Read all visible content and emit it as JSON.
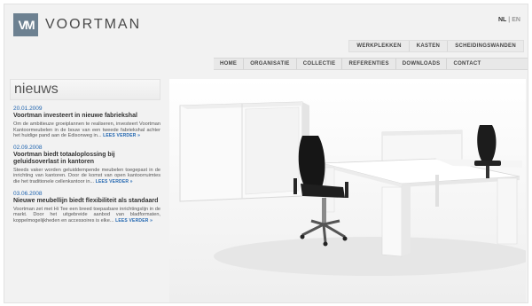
{
  "brand": {
    "mark": "VM",
    "name": "VOORTMAN"
  },
  "language": {
    "nl": "NL",
    "separator": "|",
    "en": "EN"
  },
  "top_nav": [
    "WERKPLEKKEN",
    "KASTEN",
    "SCHEIDINGSWANDEN"
  ],
  "main_nav": [
    "HOME",
    "ORGANISATIE",
    "COLLECTIE",
    "REFERENTIES",
    "DOWNLOADS",
    "CONTACT"
  ],
  "news": {
    "heading": "nieuws",
    "items": [
      {
        "date": "20.01.2009",
        "title": "Voortman investeert in nieuwe fabriekshal",
        "body": "Om de ambitieuze groeiplannen te realiseren, investeert Voortman Kantoormeubelen in de bouw van een tweede fabriekshal achter het huidige pand aan de Edisonweg in...",
        "more": "LEES VERDER »"
      },
      {
        "date": "02.09.2008",
        "title": "Voortman biedt totaaloplossing bij geluidsoverlast in kantoren",
        "body": "Steeds vaker worden geluiddempende meubelen toegepast in de inrichting van kantoren. Door de komst van open kantoorruimtes die het traditionele cellenkantoor in...",
        "more": "LEES VERDER »"
      },
      {
        "date": "03.06.2008",
        "title": "Nieuwe meubellijn biedt flexibiliteit als standaard",
        "body": "Voortman zet met Hi Tee een breed toepasbare inrichtingslijn in de markt. Door het uitgebreide aanbod van bladformaten, koppelmogelijkheden en accessoires is elke...",
        "more": "LEES VERDER »"
      }
    ]
  },
  "colors": {
    "accent": "#2266b0",
    "logo": "#6d8191",
    "background": "#f2f2f2"
  }
}
